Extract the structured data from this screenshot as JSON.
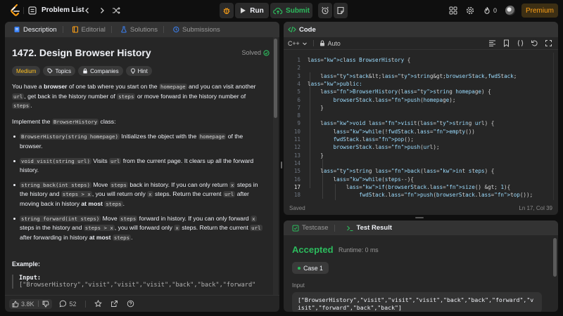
{
  "topbar": {
    "title": "Problem List",
    "run_label": "Run",
    "submit_label": "Submit",
    "streak_count": "0",
    "premium_label": "Premium"
  },
  "description_panel": {
    "tabs": [
      {
        "label": "Description"
      },
      {
        "label": "Editorial"
      },
      {
        "label": "Solutions"
      },
      {
        "label": "Submissions"
      }
    ],
    "title": "1472. Design Browser History",
    "status": "Solved",
    "chips": [
      "Medium",
      "Topics",
      "Companies",
      "Hint"
    ],
    "intro": {
      "p1": "You have a ",
      "p1_bold": "browser",
      "p2": " of one tab where you start on the ",
      "p2_code": "homepage",
      "p3": " and you can visit another ",
      "p3_code": "url",
      "p4": ", get back in the history number of ",
      "p4_code": "steps",
      "p5": " or move forward in the history number of ",
      "p5_code": "steps",
      "p6": "."
    },
    "implement": {
      "pre": "Implement the ",
      "code": "BrowserHistory",
      "post": " class:"
    },
    "bullets": [
      {
        "code": "BrowserHistory(string homepage)",
        "t1": " Initializes the object with the ",
        "code2": "homepage",
        "t2": " of the browser."
      },
      {
        "code": "void visit(string url)",
        "t1": " Visits ",
        "code2": "url",
        "t2": " from the current page. It clears up all the forward history."
      },
      {
        "code": "string back(int steps)",
        "t1": " Move ",
        "c_a": "steps",
        "t2": " back in history. If you can only return ",
        "c_b": "x",
        "t3": " steps in the history and ",
        "c_c": "steps > x",
        "t4": ", you will return only ",
        "c_d": "x",
        "t5": " steps. Return the current ",
        "c_e": "url",
        "t6": " after moving back in history ",
        "bold": "at most",
        "t7": " ",
        "c_f": "steps",
        "t8": "."
      },
      {
        "code": "string forward(int steps)",
        "t1": " Move ",
        "c_a": "steps",
        "t2": " forward in history. If you can only forward ",
        "c_b": "x",
        "t3": " steps in the history and ",
        "c_c": "steps > x",
        "t4": ", you will forward only ",
        "c_d": "x",
        "t5": " steps. Return the current ",
        "c_e": "url",
        "t6": " after forwarding in history ",
        "bold": "at most",
        "t7": " ",
        "c_f": "steps",
        "t8": "."
      }
    ],
    "example_heading": "Example:",
    "input_label": "Input:",
    "input_partial": "[\"BrowserHistory\",\"visit\",\"visit\",\"visit\",\"back\",\"back\",\"forward\"",
    "footer": {
      "likes": "3.8K",
      "comments": "52"
    }
  },
  "code_panel": {
    "tab_label": "Code",
    "language": "C++",
    "mode": "Auto",
    "status_left": "Saved",
    "status_right": "Ln 17, Col 39",
    "current_line": 17,
    "lines": [
      {
        "n": "1",
        "t": "class BrowserHistory {"
      },
      {
        "n": "2",
        "t": ""
      },
      {
        "n": "3",
        "t": "    stack<string>browserStack,fwdStack;"
      },
      {
        "n": "4",
        "t": "public:"
      },
      {
        "n": "5",
        "t": "    BrowserHistory(string homepage) {"
      },
      {
        "n": "6",
        "t": "        browserStack.push(homepage);"
      },
      {
        "n": "7",
        "t": "    }"
      },
      {
        "n": "8",
        "t": ""
      },
      {
        "n": "9",
        "t": "    void visit(string url) {"
      },
      {
        "n": "10",
        "t": "        while(!fwdStack.empty())"
      },
      {
        "n": "11",
        "t": "        fwdStack.pop();"
      },
      {
        "n": "12",
        "t": "        browserStack.push(url);"
      },
      {
        "n": "13",
        "t": "    }"
      },
      {
        "n": "14",
        "t": ""
      },
      {
        "n": "15",
        "t": "    string back(int steps) {"
      },
      {
        "n": "16",
        "t": "        while(steps--){"
      },
      {
        "n": "17",
        "t": "            if(browserStack.size() > 1){"
      },
      {
        "n": "18",
        "t": "                fwdStack.push(browserStack.top());"
      }
    ]
  },
  "result_panel": {
    "tabs": [
      {
        "label": "Testcase"
      },
      {
        "label": "Test Result"
      }
    ],
    "verdict": "Accepted",
    "runtime": "Runtime: 0 ms",
    "case_label": "Case 1",
    "input_label": "Input",
    "input_value": "[\"BrowserHistory\",\"visit\",\"visit\",\"visit\",\"back\",\"back\",\"forward\",\"visit\",\"forward\",\"back\",\"back\"]"
  },
  "colors": {
    "accent_orange": "#ffa116",
    "accepted_green": "#2cbb5d",
    "medium_yellow": "#ffc01e",
    "panel_bg": "#262626",
    "page_bg": "#0f0f0f"
  }
}
